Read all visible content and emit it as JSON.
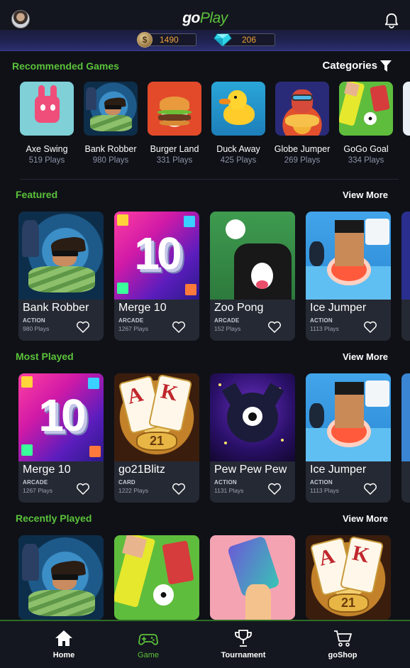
{
  "header": {
    "logo_go": "go",
    "logo_play": "Play",
    "avatar_icon": "user-avatar",
    "bell_icon": "bell-icon"
  },
  "wallet": {
    "coins": "1490",
    "coin_symbol": "$",
    "gems": "206"
  },
  "recommended": {
    "title": "Recommended Games",
    "categories_label": "Categories",
    "items": [
      {
        "name": "Axe Swing",
        "plays": "519 Plays"
      },
      {
        "name": "Bank Robber",
        "plays": "980 Plays"
      },
      {
        "name": "Burger Land",
        "plays": "331 Plays"
      },
      {
        "name": "Duck Away",
        "plays": "425 Plays"
      },
      {
        "name": "Globe Jumper",
        "plays": "269 Plays"
      },
      {
        "name": "GoGo Goal",
        "plays": "334 Plays"
      }
    ]
  },
  "featured": {
    "title": "Featured",
    "view_more": "View More",
    "cards": [
      {
        "title": "Bank Robber",
        "category": "ACTION",
        "plays": "980 Plays"
      },
      {
        "title": "Merge 10",
        "category": "ARCADE",
        "plays": "1267 Plays"
      },
      {
        "title": "Zoo Pong",
        "category": "ARCADE",
        "plays": "152 Plays"
      },
      {
        "title": "Ice Jumper",
        "category": "ACTION",
        "plays": "1113 Plays"
      }
    ]
  },
  "most_played": {
    "title": "Most Played",
    "view_more": "View More",
    "cards": [
      {
        "title": "Merge 10",
        "category": "ARCADE",
        "plays": "1267 Plays"
      },
      {
        "title": "go21Blitz",
        "category": "CARD",
        "plays": "1222 Plays"
      },
      {
        "title": "Pew Pew Pew",
        "category": "ACTION",
        "plays": "1131 Plays"
      },
      {
        "title": "Ice Jumper",
        "category": "ACTION",
        "plays": "1113 Plays"
      }
    ]
  },
  "recently_played": {
    "title": "Recently Played",
    "view_more": "View More"
  },
  "card_art": {
    "blitz_card1": "A",
    "blitz_card2": "K",
    "blitz_plaque": "21",
    "merge_number": "10"
  },
  "bottom_nav": {
    "items": [
      {
        "label": "Home",
        "icon": "home-icon"
      },
      {
        "label": "Game",
        "icon": "gamepad-icon"
      },
      {
        "label": "Tournament",
        "icon": "trophy-icon"
      },
      {
        "label": "goShop",
        "icon": "cart-icon"
      }
    ],
    "active": "Game"
  },
  "colors": {
    "accent_green": "#5bc23a",
    "background": "#0f1117",
    "card": "#252933",
    "coin_text": "#f0a13a"
  }
}
